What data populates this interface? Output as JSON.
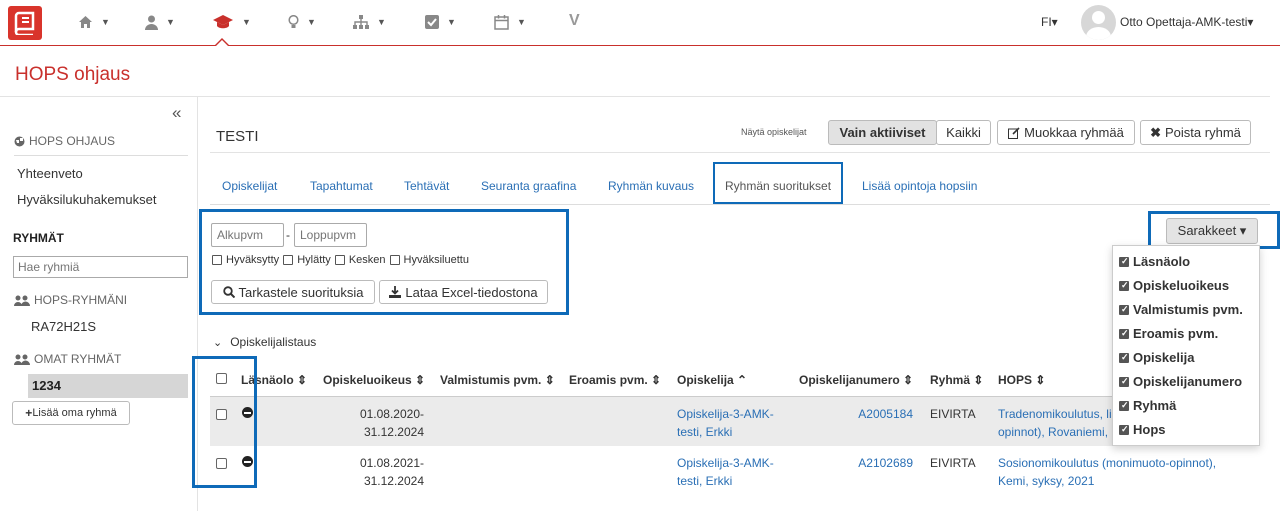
{
  "nav": {
    "items": [
      {
        "icon": "home-icon"
      },
      {
        "icon": "user-icon"
      },
      {
        "icon": "graduation-cap-icon"
      },
      {
        "icon": "lightbulb-icon"
      },
      {
        "icon": "sitemap-icon"
      },
      {
        "icon": "check-square-icon"
      },
      {
        "icon": "calendar-icon"
      }
    ],
    "v_label": "V",
    "lang": "FI▾",
    "user": "Otto Opettaja-AMK-testi▾",
    "accent": "#c9302c"
  },
  "page_title": "HOPS ohjaus",
  "sidebar": {
    "collapse": "«",
    "section_head": "HOPS OHJAUS",
    "links": [
      "Yhteenveto",
      "Hyväksilukuhakemukset"
    ],
    "groups_head": "RYHMÄT",
    "search_placeholder": "Hae ryhmiä",
    "hops_groups_label": "HOPS-RYHMÄNI",
    "hops_group": "RA72H21S",
    "own_groups_label": "OMAT RYHMÄT",
    "own_group_active": "1234",
    "add_group_label": "Lisää oma ryhmä"
  },
  "main": {
    "group_title": "TESTI",
    "show_students_label": "Näytä opiskelijat",
    "only_active_label": "Vain aktiiviset",
    "all_label": "Kaikki",
    "edit_group_label": "Muokkaa ryhmää",
    "delete_group_label": "Poista ryhmä",
    "tabs": [
      "Opiskelijat",
      "Tapahtumat",
      "Tehtävät",
      "Seuranta graafina",
      "Ryhmän kuvaus",
      "Ryhmän suoritukset",
      "Lisää opintoja hopsiin"
    ],
    "start_placeholder": "Alkupvm",
    "end_placeholder": "Loppupvm",
    "dash": "-",
    "filters": [
      "Hyväksytty",
      "Hylätty",
      "Kesken",
      "Hyväksiluettu"
    ],
    "view_button": "Tarkastele suorituksia",
    "excel_button": "Lataa Excel-tiedostona",
    "columns_button": "Sarakkeet ▾",
    "list_label": "Opiskelijalistaus",
    "headers": [
      "Läsnäolo ⇕",
      "Opiskeluoikeus ⇕",
      "Valmistumis pvm. ⇕",
      "Eroamis pvm. ⇕",
      "Opiskelija ⌃",
      "Opiskelijanumero ⇕",
      "Ryhmä ⇕",
      "HOPS ⇕"
    ],
    "rows": [
      {
        "opiskeluoikeus_1": "01.08.2020-",
        "opiskeluoikeus_2": "31.12.2024",
        "opiskelija_1": "Opiskelija-3-AMK-",
        "opiskelija_2": "testi, Erkki",
        "numero": "A2005184",
        "ryhma": "EIVIRTA",
        "hops_1": "Tradenomikoulutus, li",
        "hops_2": "opinnot), Rovaniemi, l"
      },
      {
        "opiskeluoikeus_1": "01.08.2021-",
        "opiskeluoikeus_2": "31.12.2024",
        "opiskelija_1": "Opiskelija-3-AMK-",
        "opiskelija_2": "testi, Erkki",
        "numero": "A2102689",
        "ryhma": "EIVIRTA",
        "hops_1": "Sosionomikoulutus (monimuoto-opinnot),",
        "hops_2": "Kemi, syksy, 2021"
      }
    ],
    "column_options": [
      "Läsnäolo",
      "Opiskeluoikeus",
      "Valmistumis pvm.",
      "Eroamis pvm.",
      "Opiskelija",
      "Opiskelijanumero",
      "Ryhmä",
      "Hops"
    ]
  }
}
